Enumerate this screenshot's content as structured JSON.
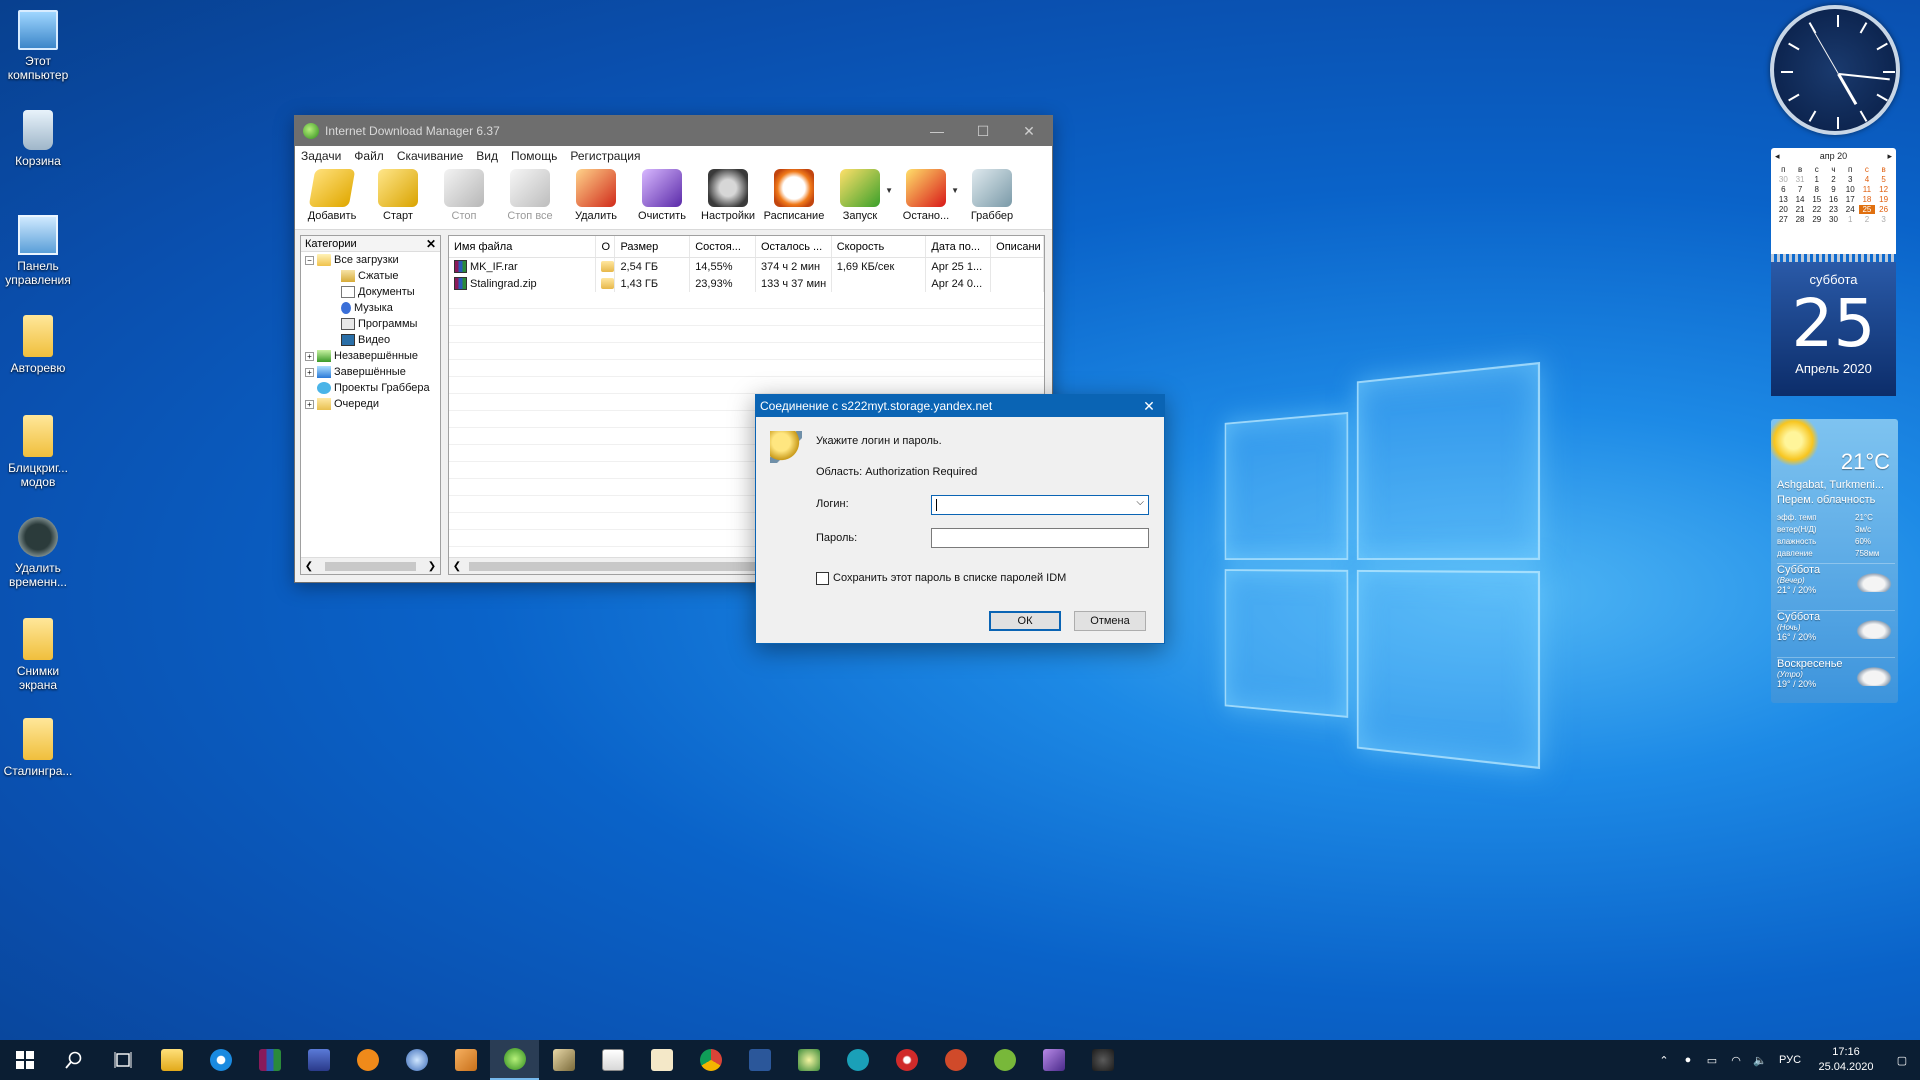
{
  "desktop": {
    "icons": [
      {
        "label": "Этот компьютер",
        "icon": "computer-icon"
      },
      {
        "label": "Корзина",
        "icon": "recycle-bin-icon"
      },
      {
        "label": "Панель управления",
        "icon": "control-panel-icon"
      },
      {
        "label": "Авторевю",
        "icon": "folder-icon"
      },
      {
        "label": "Блицкриг... модов",
        "icon": "folder-icon"
      },
      {
        "label": "Удалить временн...",
        "icon": "app-shortcut-icon"
      },
      {
        "label": "Снимки экрана",
        "icon": "folder-icon"
      },
      {
        "label": "Сталингра...",
        "icon": "folder-icon"
      }
    ]
  },
  "idm": {
    "title": "Internet Download Manager 6.37",
    "menu": [
      "Задачи",
      "Файл",
      "Скачивание",
      "Вид",
      "Помощь",
      "Регистрация"
    ],
    "toolbar": [
      {
        "label": "Добавить",
        "icon": "add-url-icon"
      },
      {
        "label": "Старт",
        "icon": "start-icon"
      },
      {
        "label": "Стоп",
        "icon": "stop-icon"
      },
      {
        "label": "Стоп все",
        "icon": "stop-all-icon"
      },
      {
        "label": "Удалить",
        "icon": "delete-icon"
      },
      {
        "label": "Очистить",
        "icon": "clean-icon"
      },
      {
        "label": "Настройки",
        "icon": "settings-gear-icon"
      },
      {
        "label": "Расписание",
        "icon": "scheduler-clock-icon"
      },
      {
        "label": "Запуск",
        "icon": "start-queue-icon"
      },
      {
        "label": "Остано...",
        "icon": "stop-queue-icon"
      },
      {
        "label": "Граббер",
        "icon": "grabber-icon"
      }
    ],
    "categories": {
      "header": "Категории",
      "close": "✕",
      "root": "Все загрузки",
      "children": [
        "Сжатые",
        "Документы",
        "Музыка",
        "Программы",
        "Видео"
      ],
      "others": [
        "Незавершённые",
        "Завершённые",
        "Проекты Граббера",
        "Очереди"
      ]
    },
    "columns": [
      "Имя файла",
      "О",
      "Размер",
      "Состоя...",
      "Осталось ...",
      "Скорость",
      "Дата по...",
      "Описани"
    ],
    "rows": [
      {
        "name": "MK_IF.rar",
        "size": "2,54 ГБ",
        "status": "14,55%",
        "left": "374 ч 2 мин",
        "speed": "1,69 КБ/сек",
        "date": "Apr 25 1..."
      },
      {
        "name": "Stalingrad.zip",
        "size": "1,43 ГБ",
        "status": "23,93%",
        "left": "133 ч 37 мин",
        "speed": "",
        "date": "Apr 24 0..."
      }
    ]
  },
  "dialog": {
    "title": "Соединение с s222myt.storage.yandex.net",
    "prompt": "Укажите логин и пароль.",
    "realm": "Область: Authorization Required",
    "login_label": "Логин:",
    "login_value": "",
    "password_label": "Пароль:",
    "password_value": "",
    "save_label": "Сохранить этот пароль в списке паролей IDM",
    "ok": "ОК",
    "cancel": "Отмена"
  },
  "calendar": {
    "month": "апр 20",
    "weekdays": [
      "п",
      "в",
      "с",
      "ч",
      "п",
      "с",
      "в"
    ],
    "weeks": [
      [
        "30",
        "31",
        "1",
        "2",
        "3",
        "4",
        "5"
      ],
      [
        "6",
        "7",
        "8",
        "9",
        "10",
        "11",
        "12"
      ],
      [
        "13",
        "14",
        "15",
        "16",
        "17",
        "18",
        "19"
      ],
      [
        "20",
        "21",
        "22",
        "23",
        "24",
        "25",
        "26"
      ],
      [
        "27",
        "28",
        "29",
        "30",
        "1",
        "2",
        "3"
      ]
    ],
    "today": "25",
    "dow": "суббота",
    "day": "25",
    "month_year": "Апрель 2020"
  },
  "weather": {
    "temp": "21°C",
    "city": "Ashgabat, Turkmeni...",
    "condition": "Перем. облачность",
    "details": [
      {
        "k": "эфф. темп",
        "v": "21°C"
      },
      {
        "k": "ветер(Н/Д)",
        "v": "3м/с"
      },
      {
        "k": "влажность",
        "v": "60%"
      },
      {
        "k": "давление",
        "v": "758мм"
      }
    ],
    "forecast": [
      {
        "day": "Суббота",
        "part": "(Вечер)",
        "val": "21° / 20%"
      },
      {
        "day": "Суббота",
        "part": "(Ночь)",
        "val": "16° / 20%"
      },
      {
        "day": "Воскресенье",
        "part": "(Утро)",
        "val": "19° / 20%"
      }
    ]
  },
  "taskbar": {
    "apps": [
      "start-icon",
      "search-icon",
      "task-view-icon",
      "file-explorer-icon",
      "edge-icon",
      "winrar-icon",
      "save-icon",
      "avast-icon",
      "app-icon",
      "box-icon",
      "idm-icon",
      "tool-icon",
      "calendar-icon",
      "dice-icon",
      "chrome-icon",
      "word-icon",
      "app-icon",
      "edge-new-icon",
      "game-icon",
      "app-icon",
      "utorrent-icon",
      "app-icon",
      "game-icon"
    ],
    "lang": "РУС",
    "time": "17:16",
    "date": "25.04.2020"
  },
  "colors": {
    "accent": "#0a64b4",
    "taskbar": "#0b1e33"
  }
}
